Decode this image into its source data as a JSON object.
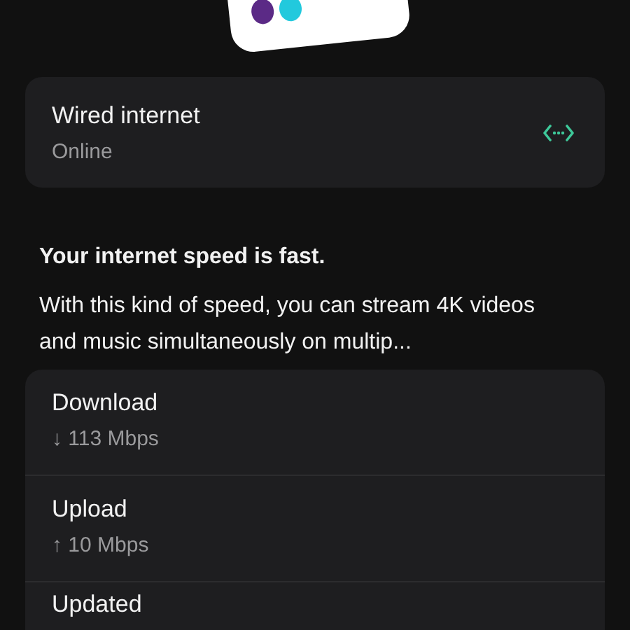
{
  "connection": {
    "title": "Wired internet",
    "status": "Online"
  },
  "speed": {
    "heading": "Your internet speed is fast.",
    "description": "With this kind of speed, you can stream 4K videos and music simultaneously on multip..."
  },
  "stats": [
    {
      "label": "Download",
      "value": "↓ 113 Mbps"
    },
    {
      "label": "Upload",
      "value": "↑ 10 Mbps"
    },
    {
      "label": "Updated"
    }
  ]
}
